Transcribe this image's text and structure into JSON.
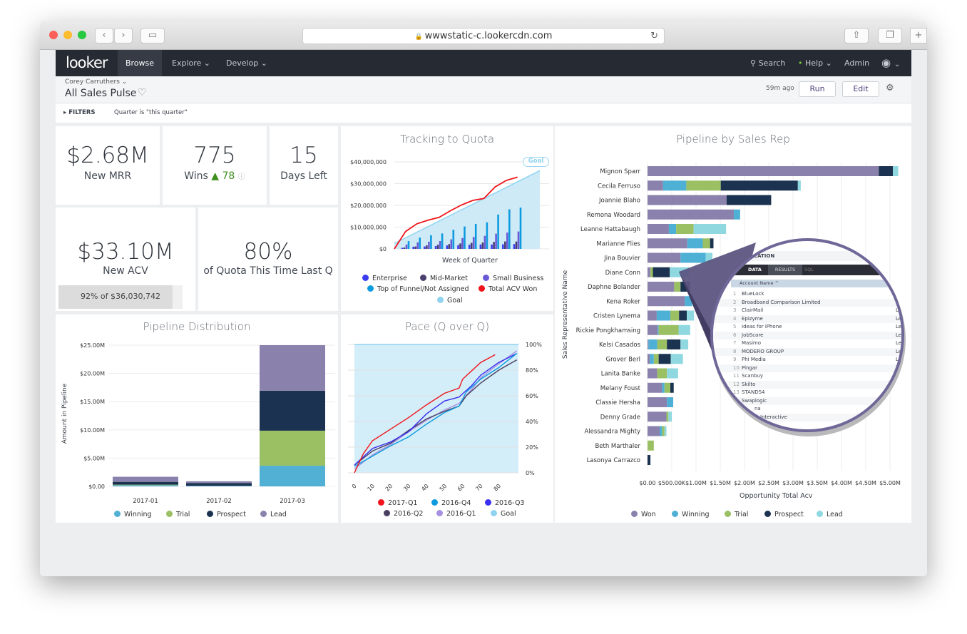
{
  "browser": {
    "url": "wwwstatic-c.lookercdn.com"
  },
  "nav": {
    "logo": "looker",
    "items": [
      "Browse",
      "Explore",
      "Develop"
    ],
    "search": "Search",
    "help": "Help",
    "admin": "Admin"
  },
  "header": {
    "owner": "Corey Carruthers",
    "title": "All Sales Pulse",
    "updated": "59m ago",
    "run": "Run",
    "edit": "Edit"
  },
  "filters": {
    "label": "FILTERS",
    "value": "Quarter is \"this quarter\""
  },
  "tiles": {
    "mrr": {
      "value": "$2.68M",
      "label": "New MRR"
    },
    "wins": {
      "value": "775",
      "label": "Wins",
      "delta": "▲ 78"
    },
    "days": {
      "value": "15",
      "label": "Days Left"
    },
    "acv": {
      "value": "$33.10M",
      "label": "New ACV",
      "progress_text": "92% of $36,030,742",
      "progress": 0.92
    },
    "quota": {
      "value": "80%",
      "label": "of Quota This Time Last Q"
    }
  },
  "chart_data": [
    {
      "id": "tracking",
      "type": "bar",
      "title": "Tracking to Quota",
      "xlabel": "Week of Quarter",
      "ylabel": "",
      "yticks": [
        "$0",
        "$10,000,000",
        "$20,000,000",
        "$30,000,000",
        "$40,000,000"
      ],
      "ylim": [
        0,
        40000000
      ],
      "goal_badge": "Goal",
      "series": [
        {
          "name": "Enterprise",
          "color": "#3b3cf0",
          "values": [
            0.5,
            1.0,
            1.1,
            1.3,
            1.6,
            1.7,
            1.9,
            2.0,
            2.0,
            2.1,
            2.2
          ]
        },
        {
          "name": "Mid-Market",
          "color": "#4a3e6e",
          "values": [
            0.6,
            1.1,
            1.6,
            1.9,
            2.2,
            2.5,
            2.8,
            2.9,
            3.2,
            3.4,
            3.4
          ]
        },
        {
          "name": "Small Business",
          "color": "#6b5ad6",
          "values": [
            2.0,
            3.0,
            3.3,
            3.6,
            4.4,
            5.0,
            5.5,
            6.0,
            7.0,
            7.5,
            8.0
          ]
        },
        {
          "name": "Top of Funnel/Not Assigned",
          "color": "#0d9be0",
          "values": [
            3.6,
            5.2,
            6.3,
            7.1,
            8.8,
            10.3,
            11.5,
            12.2,
            15.8,
            18.2,
            19.0
          ]
        },
        {
          "name": "Total ACV Won",
          "color": "#f0141a",
          "type": "line",
          "values": [
            0,
            8,
            11.5,
            13.2,
            14.5,
            17.5,
            20.2,
            22.3,
            23.2,
            28.5,
            31.5,
            33
          ]
        },
        {
          "name": "Goal",
          "color": "#8fd3f0",
          "type": "area",
          "values": [
            2.5,
            36
          ]
        }
      ],
      "unit": "$M"
    },
    {
      "id": "pace",
      "type": "line",
      "title": "Pace (Q over Q)",
      "xticks": [
        "0",
        "10",
        "20",
        "30",
        "40",
        "50",
        "60",
        "70",
        "80"
      ],
      "yticks": [
        "0%",
        "20%",
        "40%",
        "60%",
        "80%",
        "100%"
      ],
      "ylim": [
        0,
        100
      ],
      "series": [
        {
          "name": "2017-Q1",
          "color": "#f0141a",
          "points": [
            [
              0,
              0
            ],
            [
              5,
              15
            ],
            [
              10,
              25
            ],
            [
              20,
              34
            ],
            [
              30,
              43
            ],
            [
              40,
              53
            ],
            [
              50,
              62
            ],
            [
              58,
              66
            ],
            [
              60,
              73
            ],
            [
              70,
              86
            ],
            [
              78,
              92
            ]
          ]
        },
        {
          "name": "2016-Q4",
          "color": "#0d9be0",
          "points": [
            [
              0,
              5
            ],
            [
              10,
              13
            ],
            [
              20,
              21
            ],
            [
              30,
              28
            ],
            [
              40,
              38
            ],
            [
              50,
              47
            ],
            [
              58,
              52
            ],
            [
              62,
              63
            ],
            [
              70,
              73
            ],
            [
              80,
              82
            ],
            [
              90,
              93
            ]
          ]
        },
        {
          "name": "2016-Q3",
          "color": "#3a2ff0",
          "points": [
            [
              0,
              6
            ],
            [
              10,
              19
            ],
            [
              20,
              24
            ],
            [
              30,
              32
            ],
            [
              40,
              46
            ],
            [
              50,
              56
            ],
            [
              58,
              59
            ],
            [
              65,
              68
            ],
            [
              70,
              76
            ],
            [
              80,
              86
            ],
            [
              90,
              93
            ]
          ]
        },
        {
          "name": "2016-Q2",
          "color": "#4a3f60",
          "points": [
            [
              0,
              6
            ],
            [
              10,
              17
            ],
            [
              20,
              23
            ],
            [
              30,
              33
            ],
            [
              40,
              42
            ],
            [
              50,
              48
            ],
            [
              58,
              52
            ],
            [
              62,
              60
            ],
            [
              70,
              70
            ],
            [
              80,
              80
            ],
            [
              90,
              88
            ]
          ]
        },
        {
          "name": "2016-Q1",
          "color": "#a890e0",
          "points": [
            [
              0,
              3
            ],
            [
              10,
              14
            ],
            [
              20,
              22
            ],
            [
              30,
              32
            ],
            [
              40,
              41
            ],
            [
              50,
              49
            ],
            [
              58,
              54
            ],
            [
              65,
              65
            ],
            [
              70,
              74
            ],
            [
              80,
              85
            ],
            [
              90,
              95
            ]
          ]
        },
        {
          "name": "Goal",
          "color": "#8fd3f0",
          "points": [
            [
              0,
              100
            ],
            [
              91,
              100
            ]
          ]
        }
      ]
    },
    {
      "id": "distribution",
      "type": "bar",
      "stacked": true,
      "title": "Pipeline Distribution",
      "ylabel": "Amount in Pipeline",
      "ylim": [
        0,
        25
      ],
      "yticks": [
        "$0.00",
        "$5.00M",
        "$10.00M",
        "$15.00M",
        "$20.00M",
        "$25.00M"
      ],
      "categories": [
        "2017-01",
        "2017-02",
        "2017-03"
      ],
      "series": [
        {
          "name": "Winning",
          "color": "#52b0d5",
          "values": [
            0.2,
            0.1,
            3.66
          ]
        },
        {
          "name": "Trial",
          "color": "#9bc063",
          "values": [
            0.1,
            0.0,
            6.2
          ]
        },
        {
          "name": "Prospect",
          "color": "#1b3350",
          "values": [
            0.5,
            0.5,
            7.07
          ]
        },
        {
          "name": "Lead",
          "color": "#8a82ad",
          "values": [
            0.9,
            0.3,
            8.07
          ]
        }
      ],
      "unit": "$M"
    },
    {
      "id": "reps",
      "type": "bar",
      "orientation": "horizontal",
      "stacked": true,
      "title": "Pipeline by Sales Rep",
      "ylabel": "Sales Representative Name",
      "xlabel": "Opportunity Total Acv",
      "xlim": [
        0,
        5.2
      ],
      "xticks": [
        "$0.00",
        "$500.00K",
        "$1.00M",
        "$1.50M",
        "$2.00M",
        "$2.50M",
        "$3.00M",
        "$3.50M",
        "$4.00M",
        "$4.50M",
        "$5.00M"
      ],
      "categories": [
        "Mignon Sparr",
        "Cecila Ferruso",
        "Joannie Blaho",
        "Remona Woodard",
        "Leanne Hattabaugh",
        "Marianne Flies",
        "Jina Bouvier",
        "Diane Conn",
        "Daphne Bolander",
        "Kena Roker",
        "Cristen Lynema",
        "Rickie Pongkhamsing",
        "Kelsi Casados",
        "Grover Berl",
        "Lanita Banke",
        "Melany Foust",
        "Classie Hersha",
        "Denny Grade",
        "Alessandra Mighty",
        "Beth Marthaler",
        "Lasonya Carrazco"
      ],
      "series": [
        {
          "name": "Won",
          "color": "#8a82ad",
          "values": [
            4.77,
            0.32,
            1.63,
            1.78,
            0.44,
            0.82,
            0.68,
            0.06,
            0.55,
            0.77,
            0.19,
            0.21,
            0.02,
            0.05,
            0.2,
            0.3,
            0.4,
            0.39,
            0.25,
            0,
            0
          ]
        },
        {
          "name": "Winning",
          "color": "#4fb0d6",
          "values": [
            0,
            0.48,
            0,
            0.13,
            0.15,
            0.32,
            0.52,
            0,
            0,
            0.15,
            0.28,
            0.02,
            0.18,
            0.08,
            0,
            0.05,
            0.13,
            0,
            0.05,
            0,
            0
          ]
        },
        {
          "name": "Trial",
          "color": "#9bc063",
          "values": [
            0,
            0.71,
            0,
            0,
            0.36,
            0.15,
            0,
            0.05,
            0.13,
            0,
            0.18,
            0.41,
            0.2,
            0.1,
            0.2,
            0.12,
            0,
            0.04,
            0.05,
            0.13,
            0
          ]
        },
        {
          "name": "Prospect",
          "color": "#1b3350",
          "values": [
            0.29,
            1.59,
            0.92,
            0,
            0,
            0.07,
            0,
            0.35,
            0.2,
            0,
            0.16,
            0,
            0.28,
            0.25,
            0,
            0.07,
            0,
            0,
            0,
            0,
            0.06
          ]
        },
        {
          "name": "Lead",
          "color": "#8fd8e0",
          "values": [
            0.11,
            0.06,
            0,
            0,
            0.67,
            0,
            0.14,
            0.4,
            0,
            0,
            0.15,
            0.24,
            0.16,
            0.25,
            0.23,
            0,
            0,
            0.07,
            0.04,
            0,
            0
          ]
        }
      ],
      "unit": "$M"
    }
  ],
  "magnifier": {
    "section": "LIZATION",
    "tabs": [
      "DATA",
      "RESULTS",
      "SQL"
    ],
    "column": "Account Name ^",
    "rows": [
      "BlueLock",
      "Broadband Comparison Limited",
      "ClairMail",
      "Epizyme",
      "Ideas for iPhone",
      "JobScore",
      "Masimo",
      "MODERO GROUP",
      "Phi Media",
      "Pingar",
      "Scanbuy",
      "Skilto",
      "STANDS4",
      "Swaplogic",
      "na",
      "Interactive"
    ],
    "right_value": "Lead"
  }
}
